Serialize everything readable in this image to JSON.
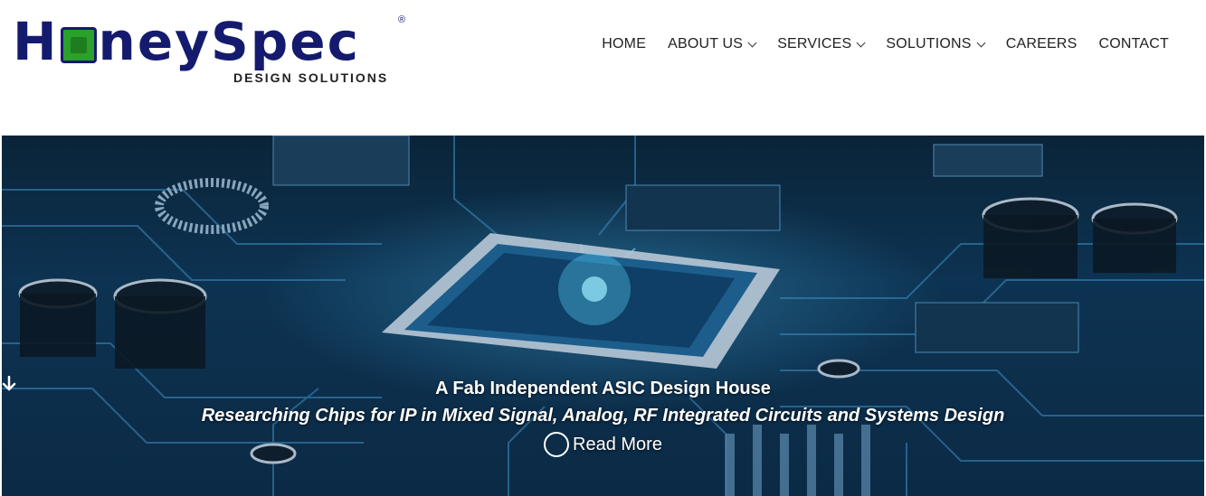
{
  "logo": {
    "word_start": "H",
    "word_rest": "neySpec",
    "registered": "®",
    "tagline": "DESIGN SOLUTIONS"
  },
  "nav": {
    "items": [
      {
        "label": "HOME",
        "dropdown": false
      },
      {
        "label": "ABOUT US",
        "dropdown": true
      },
      {
        "label": "SERVICES",
        "dropdown": true
      },
      {
        "label": "SOLUTIONS",
        "dropdown": true
      },
      {
        "label": "CAREERS",
        "dropdown": false
      },
      {
        "label": "CONTACT",
        "dropdown": false
      }
    ]
  },
  "hero": {
    "title": "A Fab Independent ASIC Design House",
    "subtitle": "Researching Chips for IP in Mixed Signal, Analog, RF Integrated Circuits and Systems Design",
    "cta": "Read More",
    "cta_icon": "arrow-down-circle-icon"
  },
  "colors": {
    "brand": "#141b6e",
    "chip_green": "#2aa12a",
    "hero_dark": "#0b2a45",
    "glow": "#50c8ff"
  }
}
